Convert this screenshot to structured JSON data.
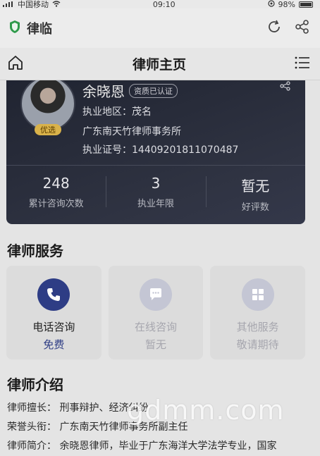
{
  "status_bar": {
    "carrier": "中国移动",
    "time": "09:10",
    "battery": "98%"
  },
  "app_bar": {
    "title": "律临"
  },
  "nav": {
    "title": "律师主页"
  },
  "profile": {
    "name": "余晓恩",
    "cert_badge": "资质已认证",
    "featured_badge": "优选",
    "region": "执业地区：茂名",
    "firm": "广东南天竹律师事务所",
    "license": "执业证号：14409201811070487",
    "stats": [
      {
        "value": "248",
        "label": "累计咨询次数"
      },
      {
        "value": "3",
        "label": "执业年限"
      },
      {
        "value": "暂无",
        "label": "好评数"
      }
    ]
  },
  "services_title": "律师服务",
  "services": [
    {
      "label": "电话咨询",
      "sub": "免费",
      "icon": "phone-icon"
    },
    {
      "label": "在线咨询",
      "sub": "暂无",
      "icon": "chat-icon"
    },
    {
      "label": "其他服务",
      "sub": "敬请期待",
      "icon": "grid-icon"
    }
  ],
  "intro_title": "律师介绍",
  "intro": {
    "specialty": "律师擅长：  刑事辩护、经济纠纷",
    "honor": "荣誉头衔：  广东南天竹律师事务所副主任",
    "bio": "律师简介：  余晓恩律师，毕业于广东海洋大学法学专业，国家"
  },
  "watermark": "gdmm.com",
  "colors": {
    "accent": "#2e3d85",
    "badge": "#d9b24a",
    "card": "#2a2e3c",
    "shield": "#2e9a4a"
  }
}
